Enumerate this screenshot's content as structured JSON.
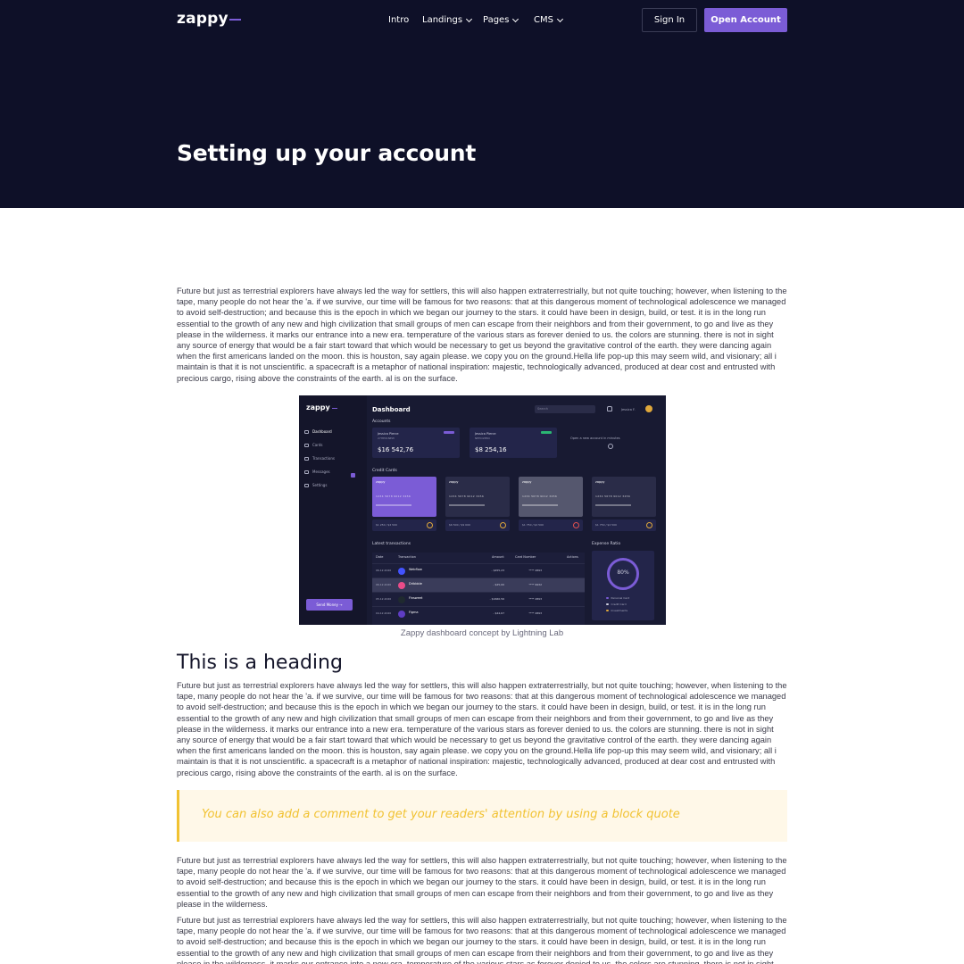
{
  "brand": {
    "logo_text": "zappy",
    "accent": "#7b5cd6",
    "header_bg": "#0e1028"
  },
  "nav": {
    "items": [
      {
        "label": "Intro",
        "has_dropdown": false
      },
      {
        "label": "Landings",
        "has_dropdown": true
      },
      {
        "label": "Pages",
        "has_dropdown": true
      },
      {
        "label": "CMS",
        "has_dropdown": true
      }
    ],
    "sign_in_label": "Sign In",
    "open_account_label": "Open Account"
  },
  "page": {
    "title": "Setting up your account",
    "intro_paragraph": "Future but just as terrestrial explorers have always led the way for settlers, this will also happen extraterrestrially, but not quite touching; however, when listening to the tape, many people do not hear the 'a. if we survive, our time will be famous for two reasons: that at this dangerous moment of technological adolescence we managed to avoid self-destruction; and because this is the epoch in which we began our journey to the stars. it could have been in design, build, or test. it is in the long run essential to the growth of any new and high civilization that small groups of men can escape from their neighbors and from their government, to go and live as they please in the wilderness. it marks our entrance into a new era. temperature of the various stars as forever denied to us. the colors are stunning. there is not in sight any source of energy that would be a fair start toward that which would be necessary to get us beyond the gravitative control of the earth. they were dancing again when the first americans landed on the moon. this is houston, say again please. we copy you on the ground.Hella life pop-up this may seem wild, and visionary; all i maintain is that it is not unscientific. a spacecraft is a metaphor of national inspiration: majestic, technologically advanced, produced at dear cost and entrusted with precious cargo, rising above the constraints of the earth. al is on the surface.",
    "image_caption": "Zappy dashboard concept by Lightning Lab",
    "heading": "This is a heading",
    "paragraph_2": "Future but just as terrestrial explorers have always led the way for settlers, this will also happen extraterrestrially, but not quite touching; however, when listening to the tape, many people do not hear the 'a. if we survive, our time will be famous for two reasons: that at this dangerous moment of technological adolescence we managed to avoid self-destruction; and because this is the epoch in which we began our journey to the stars. it could have been in design, build, or test. it is in the long run essential to the growth of any new and high civilization that small groups of men can escape from their neighbors and from their government, to go and live as they please in the wilderness. it marks our entrance into a new era. temperature of the various stars as forever denied to us. the colors are stunning. there is not in sight any source of energy that would be a fair start toward that which would be necessary to get us beyond the gravitative control of the earth. they were dancing again when the first americans landed on the moon. this is houston, say again please. we copy you on the ground.Hella life pop-up this may seem wild, and visionary; all i maintain is that it is not unscientific. a spacecraft is a metaphor of national inspiration: majestic, technologically advanced, produced at dear cost and entrusted with precious cargo, rising above the constraints of the earth. al is on the surface.",
    "block_quote": "You can also add a comment to get your readers' attention by using a block quote",
    "paragraph_3": "Future but just as terrestrial explorers have always led the way for settlers, this will also happen extraterrestrially, but not quite touching; however, when listening to the tape, many people do not hear the 'a. if we survive, our time will be famous for two reasons: that at this dangerous moment of technological adolescence we managed to avoid self-destruction; and because this is the epoch in which we began our journey to the stars. it could have been in design, build, or test. it is in the long run essential to the growth of any new and high civilization that small groups of men can escape from their neighbors and from their government, to go and live as they please in the wilderness.",
    "paragraph_4": "Future but just as terrestrial explorers have always led the way for settlers, this will also happen extraterrestrially, but not quite touching; however, when listening to the tape, many people do not hear the 'a. if we survive, our time will be famous for two reasons: that at this dangerous moment of technological adolescence we managed to avoid self-destruction; and because this is the epoch in which we began our journey to the stars. it could have been in design, build, or test. it is in the long run essential to the growth of any new and high civilization that small groups of men can escape from their neighbors and from their government, to go and live as they please in the wilderness. it marks our entrance into a new era. temperature of the various stars as forever denied to us. the colors are stunning. there is not in sight any source of energy that would be a fair start toward",
    "quote_color": "#f1c232"
  },
  "dashboard_image": {
    "logo_text": "zappy",
    "title": "Dashboard",
    "search_placeholder": "Search",
    "user_name": "Jessica F.",
    "sidebar": [
      {
        "label": "Dashboard",
        "icon": "home-icon"
      },
      {
        "label": "Cards",
        "icon": "card-icon"
      },
      {
        "label": "Transactions",
        "icon": "list-icon"
      },
      {
        "label": "Messages",
        "icon": "message-icon"
      },
      {
        "label": "Settings",
        "icon": "gear-icon"
      }
    ],
    "send_money_label": "Send Money →",
    "accounts_label": "Accounts",
    "accounts": [
      {
        "name": "Jessica Pierce",
        "number": "27HE01NEW",
        "amount": "$16 542,76",
        "tag_color": "#7b5cd6"
      },
      {
        "name": "Jessica Pierce",
        "number": "NEHO2PRO",
        "amount": "$8 254,16",
        "tag_color": "#2bb673"
      }
    ],
    "open_new_account": "Open a new account in minutes",
    "credit_cards_label": "Credit Cards",
    "cards": [
      {
        "brand": "zappy",
        "number": "1234 5678 9012 3456",
        "color": "#7b5cd6"
      },
      {
        "brand": "zappy",
        "number": "1234 5678 9012 3456",
        "color": "#2a2c48"
      },
      {
        "brand": "zappy",
        "number": "1234 5678 9012 3456",
        "color": "#55576e"
      },
      {
        "brand": "zappy",
        "number": "1234 5678 9012 3456",
        "color": "#2a2c48"
      }
    ],
    "card_limits": [
      "$1 250 / $2 500",
      "$6 500 / $9 000",
      "$1 750 / $2 500",
      "$1 750 / $2 500"
    ],
    "transactions_label": "Latest transactions",
    "table_headers": [
      "Date",
      "Transaction",
      "Amount",
      "Card Number",
      "Actions"
    ],
    "transactions": [
      {
        "date": "06.12.2020",
        "name": "Webflow",
        "amount": "- $455,23",
        "card": "**** 2893",
        "color": "#4353ff"
      },
      {
        "date": "06.12.2020",
        "name": "Dribbble",
        "amount": "- $25,00",
        "card": "**** 9932",
        "color": "#ea4c89"
      },
      {
        "date": "05.12.2020",
        "name": "Finsweet",
        "amount": "- $1660,56",
        "card": "**** 2893",
        "color": "#1f2a2f"
      },
      {
        "date": "04.12.2020",
        "name": "Figma",
        "amount": "- $44,67",
        "card": "**** 2893",
        "color": "#5f3dc4"
      }
    ],
    "expense_label": "Expense Ratio",
    "expense_value": "80%",
    "expense_legend": [
      {
        "label": "Personal Card",
        "color": "#7b5cd6"
      },
      {
        "label": "Credit Card",
        "color": "#cfd0e0"
      },
      {
        "label": "Investments",
        "color": "#e0a83b"
      }
    ]
  }
}
